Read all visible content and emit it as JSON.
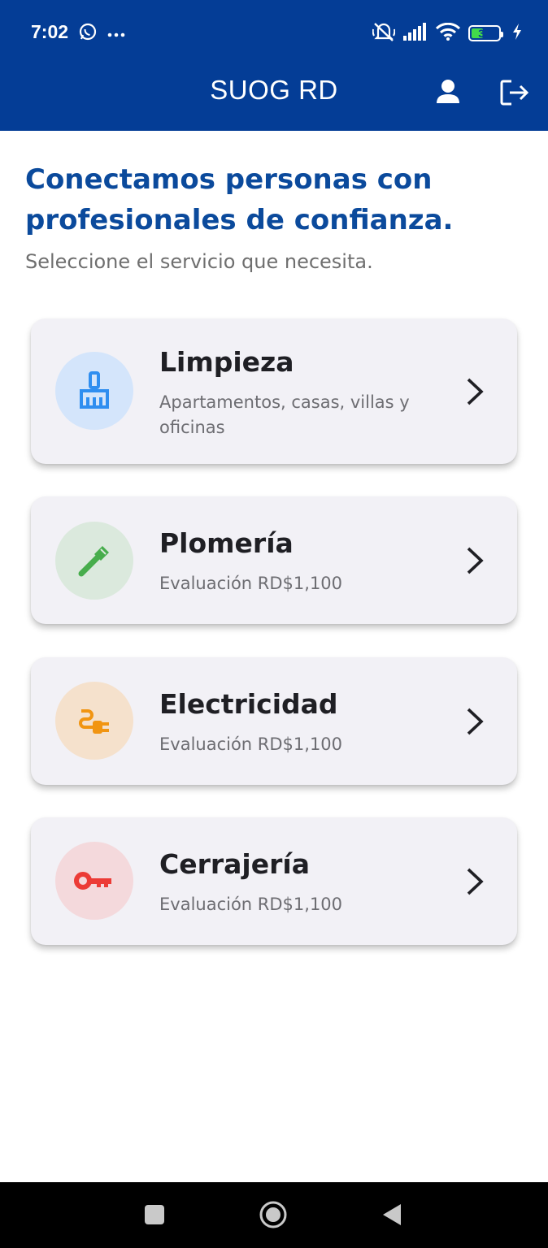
{
  "status_bar": {
    "time": "7:02",
    "battery_level": "39",
    "left_icons": [
      "whatsapp-icon",
      "more-icon"
    ],
    "right_icons": [
      "silent-icon",
      "signal-icon",
      "wifi-icon",
      "battery-icon",
      "charging-icon"
    ]
  },
  "app_bar": {
    "title": "SUOG RD",
    "actions": [
      "profile-icon",
      "logout-icon"
    ]
  },
  "main": {
    "headline": "Conectamos personas con profesionales de confianza.",
    "subtitle": "Seleccione el servicio que necesita.",
    "services": [
      {
        "title": "Limpieza",
        "subtitle": "Apartamentos, casas, villas y oficinas",
        "icon": "broom-icon",
        "bg_color": "#d4e5fb",
        "icon_color": "#2f8ef0"
      },
      {
        "title": "Plomería",
        "subtitle": "Evaluación RD$1,100",
        "icon": "wrench-icon",
        "bg_color": "#dbe9dd",
        "icon_color": "#47ad4c"
      },
      {
        "title": "Electricidad",
        "subtitle": "Evaluación RD$1,100",
        "icon": "plug-icon",
        "bg_color": "#f5e1cc",
        "icon_color": "#f19512"
      },
      {
        "title": "Cerrajería",
        "subtitle": "Evaluación RD$1,100",
        "icon": "key-icon",
        "bg_color": "#f4d9dc",
        "icon_color": "#ec3b36"
      }
    ]
  },
  "colors": {
    "primary": "#043d96",
    "headline": "#0b4a9c",
    "card_bg": "#f2f1f6"
  },
  "nav_bar": {
    "buttons": [
      "recents-icon",
      "home-icon",
      "back-icon"
    ]
  }
}
